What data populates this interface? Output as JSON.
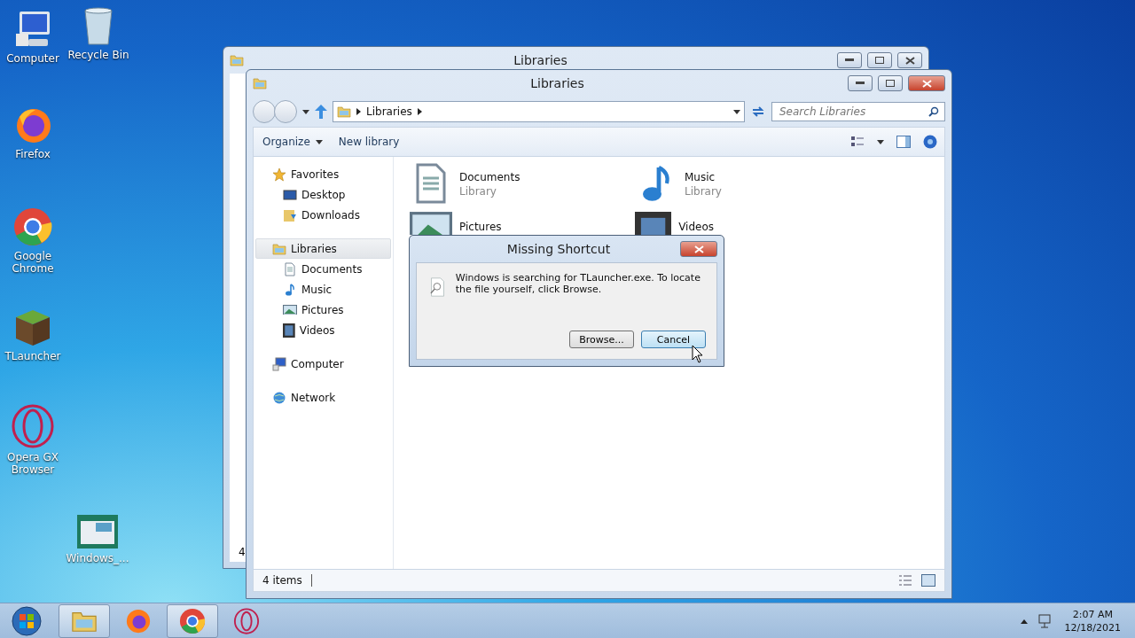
{
  "desktop_icons": [
    {
      "kind": "computer",
      "label": "Computer"
    },
    {
      "kind": "recycle",
      "label": "Recycle Bin"
    },
    {
      "kind": "firefox",
      "label": "Firefox"
    },
    {
      "kind": "chrome",
      "label": "Google Chrome"
    },
    {
      "kind": "grass",
      "label": "TLauncher"
    },
    {
      "kind": "opera",
      "label": "Opera GX Browser"
    },
    {
      "kind": "screenshot",
      "label": "Windows_..."
    }
  ],
  "back_window": {
    "title": "Libraries",
    "status_fragment": "4"
  },
  "window": {
    "title": "Libraries",
    "breadcrumb": [
      "Libraries"
    ],
    "search": {
      "placeholder": "Search Libraries"
    },
    "toolbar": [
      {
        "label": "Organize",
        "dropdown": true
      },
      {
        "label": "New library",
        "dropdown": false
      }
    ],
    "nav": [
      {
        "kind": "favorites",
        "label": "Favorites",
        "selected": false,
        "children": [
          {
            "kind": "desktop",
            "label": "Desktop",
            "selected": false
          },
          {
            "kind": "downloads",
            "label": "Downloads",
            "selected": false
          }
        ]
      },
      {
        "kind": "libraries",
        "label": "Libraries",
        "selected": true,
        "children": [
          {
            "kind": "documents",
            "label": "Documents",
            "selected": false
          },
          {
            "kind": "music",
            "label": "Music",
            "selected": false
          },
          {
            "kind": "pictures",
            "label": "Pictures",
            "selected": false
          },
          {
            "kind": "videos",
            "label": "Videos",
            "selected": false
          }
        ]
      },
      {
        "kind": "computer",
        "label": "Computer",
        "selected": false
      },
      {
        "kind": "network",
        "label": "Network",
        "selected": false
      }
    ],
    "items": [
      {
        "kind": "documents",
        "name": "Documents",
        "subtitle": "Library"
      },
      {
        "kind": "music",
        "name": "Music",
        "subtitle": "Library"
      },
      {
        "kind": "pictures",
        "name": "Pictures"
      },
      {
        "kind": "videos",
        "name": "Videos"
      }
    ],
    "status": "4 items"
  },
  "dialog": {
    "title": "Missing Shortcut",
    "message": "Windows is searching for TLauncher.exe. To locate the file yourself, click Browse.",
    "buttons": [
      {
        "label": "Browse...",
        "default": false
      },
      {
        "label": "Cancel",
        "default": true
      }
    ]
  },
  "taskbar": {
    "apps": [
      {
        "kind": "explorer",
        "open": true
      },
      {
        "kind": "firefox",
        "open": false
      },
      {
        "kind": "chrome",
        "open": true
      },
      {
        "kind": "opera",
        "open": false
      }
    ],
    "time": "2:07 AM",
    "date": "12/18/2021"
  }
}
